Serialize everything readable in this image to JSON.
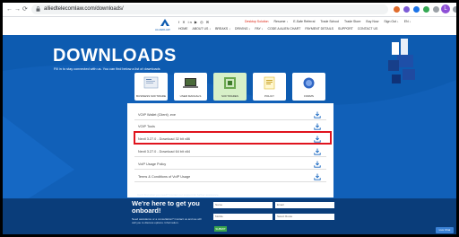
{
  "browser": {
    "back_glyph": "←",
    "forward_glyph": "→",
    "reload_glyph": "⟳",
    "url": "alliedtelecomlaw.com/downloads/",
    "profile_initial": "L",
    "extension_colors": [
      "#e06c2c",
      "#7b5bd6",
      "#1a73e8",
      "#34a853",
      "#9aa0a6",
      "#9aa0a6",
      "#9aa0a6"
    ]
  },
  "site": {
    "logo_text": "ALLIEDLAW",
    "social_text": "f ✕ in ▶ ◎ ✉",
    "top_links": [
      {
        "label": "Desktop Solution",
        "accent": true
      },
      {
        "label": "Resume ↓"
      },
      {
        "label": "E-Safe Referral"
      },
      {
        "label": "Trade School"
      },
      {
        "label": "Trade Store"
      },
      {
        "label": "Buy Now"
      },
      {
        "label": "Sign Out ↓"
      },
      {
        "label": "EN ↓"
      }
    ],
    "nav": [
      "HOME",
      "ABOUT US ↓",
      "BREAKS ↓",
      "DRIVING ↓",
      "PAY ↓",
      "CODE A ALIEN CHART",
      "PAYMENT DETAILS",
      "SUPPORT",
      "CONTACT US"
    ]
  },
  "hero": {
    "title": "DOWNLOADS",
    "subtitle": "Fill in to stay connected with us. You can find below a list of downloads"
  },
  "categories": [
    {
      "label": "BUSINESS SOFTWARE",
      "active": false
    },
    {
      "label": "USER MANUALS",
      "active": false
    },
    {
      "label": "SOFTWARES",
      "active": true
    },
    {
      "label": "POLICY",
      "active": false
    },
    {
      "label": "FORMS",
      "active": false
    }
  ],
  "downloads": [
    {
      "label": "VOIP Wallet (Client) .exe",
      "highlighted": false
    },
    {
      "label": "VOIP Tools",
      "highlighted": true
    },
    {
      "label": "Nextl 3.27.0 - Download 32 bit x86",
      "highlighted": false
    },
    {
      "label": "Nextl 3.27.0 - Download 64 bit x64",
      "highlighted": false
    },
    {
      "label": "VoIP Usage Policy",
      "highlighted": false
    },
    {
      "label": "Terms & Conditions of VoIP Usage",
      "highlighted": false
    }
  ],
  "panel_note": "Can't find what you need? Contact our support for further assistance.",
  "cta": {
    "title": "We're here to get you onboard!",
    "text": "Need assistance or a consultation? Contact us and we will call you to discuss options. Information.",
    "fields": [
      {
        "label": "Name"
      },
      {
        "label": "Email"
      },
      {
        "label": "Mobile"
      },
      {
        "label": "Select Route"
      }
    ],
    "submit": "SUBMIT"
  },
  "chat_label": "Live Chat"
}
